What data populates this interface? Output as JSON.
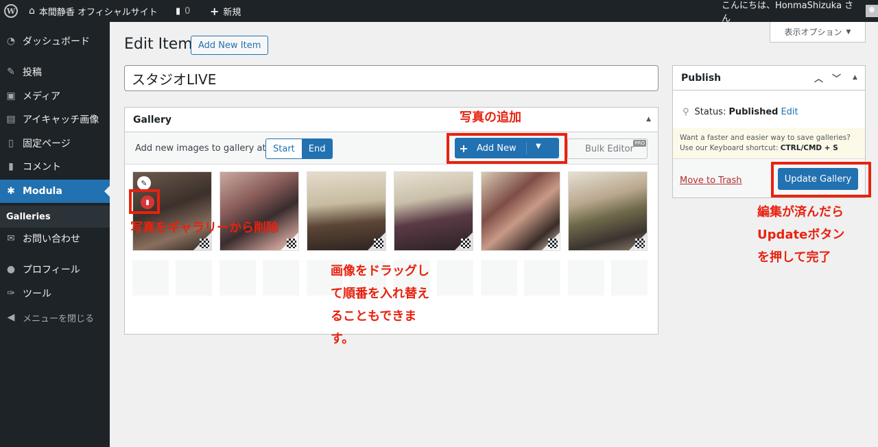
{
  "adminbar": {
    "site_name": "本間静香 オフィシャルサイト",
    "comments_count": "0",
    "new_label": "新規",
    "greeting": "こんにちは、HonmaShizuka さん"
  },
  "sidebar": {
    "items": [
      {
        "label": "ダッシュボード",
        "icon": "dashboard-icon",
        "glyph": "◔"
      },
      {
        "label": "投稿",
        "icon": "pin-icon",
        "glyph": "✎"
      },
      {
        "label": "メディア",
        "icon": "media-icon",
        "glyph": "▣"
      },
      {
        "label": "アイキャッチ画像",
        "icon": "image-icon",
        "glyph": "▤"
      },
      {
        "label": "固定ページ",
        "icon": "page-icon",
        "glyph": "▯"
      },
      {
        "label": "コメント",
        "icon": "comment-icon",
        "glyph": "▮"
      },
      {
        "label": "Modula",
        "icon": "gear-icon",
        "glyph": "✱"
      },
      {
        "label": "お問い合わせ",
        "icon": "mail-icon",
        "glyph": "✉"
      },
      {
        "label": "プロフィール",
        "icon": "user-icon",
        "glyph": "●"
      },
      {
        "label": "ツール",
        "icon": "wrench-icon",
        "glyph": "✑"
      },
      {
        "label": "メニューを閉じる",
        "icon": "collapse-icon",
        "glyph": "◀"
      }
    ],
    "submenu_label": "Galleries"
  },
  "screen_options": "表示オプション",
  "page": {
    "title": "Edit Item",
    "add_new_label": "Add New Item",
    "item_title": "スタジオLIVE"
  },
  "gallery": {
    "header": "Gallery",
    "add_text": "Add new images to gallery at",
    "start_label": "Start",
    "end_label": "End",
    "add_new_label": "Add New",
    "bulk_label": "Bulk Editor",
    "pro_label": "PRO"
  },
  "publish": {
    "header": "Publish",
    "status_label": "Status:",
    "status_value": "Published",
    "edit_link": "Edit",
    "promo_line1": "Want a faster and easier way to save galleries?",
    "promo_line2": "Use our Keyboard shortcut:",
    "promo_shortcut": "CTRL/CMD + S",
    "trash_label": "Move to Trash",
    "update_label": "Update Gallery"
  },
  "annotations": {
    "add_photo": "写真の追加",
    "delete_photo": "写真をギャラリーから削除",
    "drag": [
      "画像をドラッグし",
      "て順番を入れ替え",
      "ることもできま",
      "す。"
    ],
    "update": [
      "編集が済んだら",
      "Updateボタン",
      "を押して完了"
    ]
  },
  "colors": {
    "accent": "#2271b1",
    "annotation": "#e8220f",
    "admin_dark": "#1d2327"
  }
}
